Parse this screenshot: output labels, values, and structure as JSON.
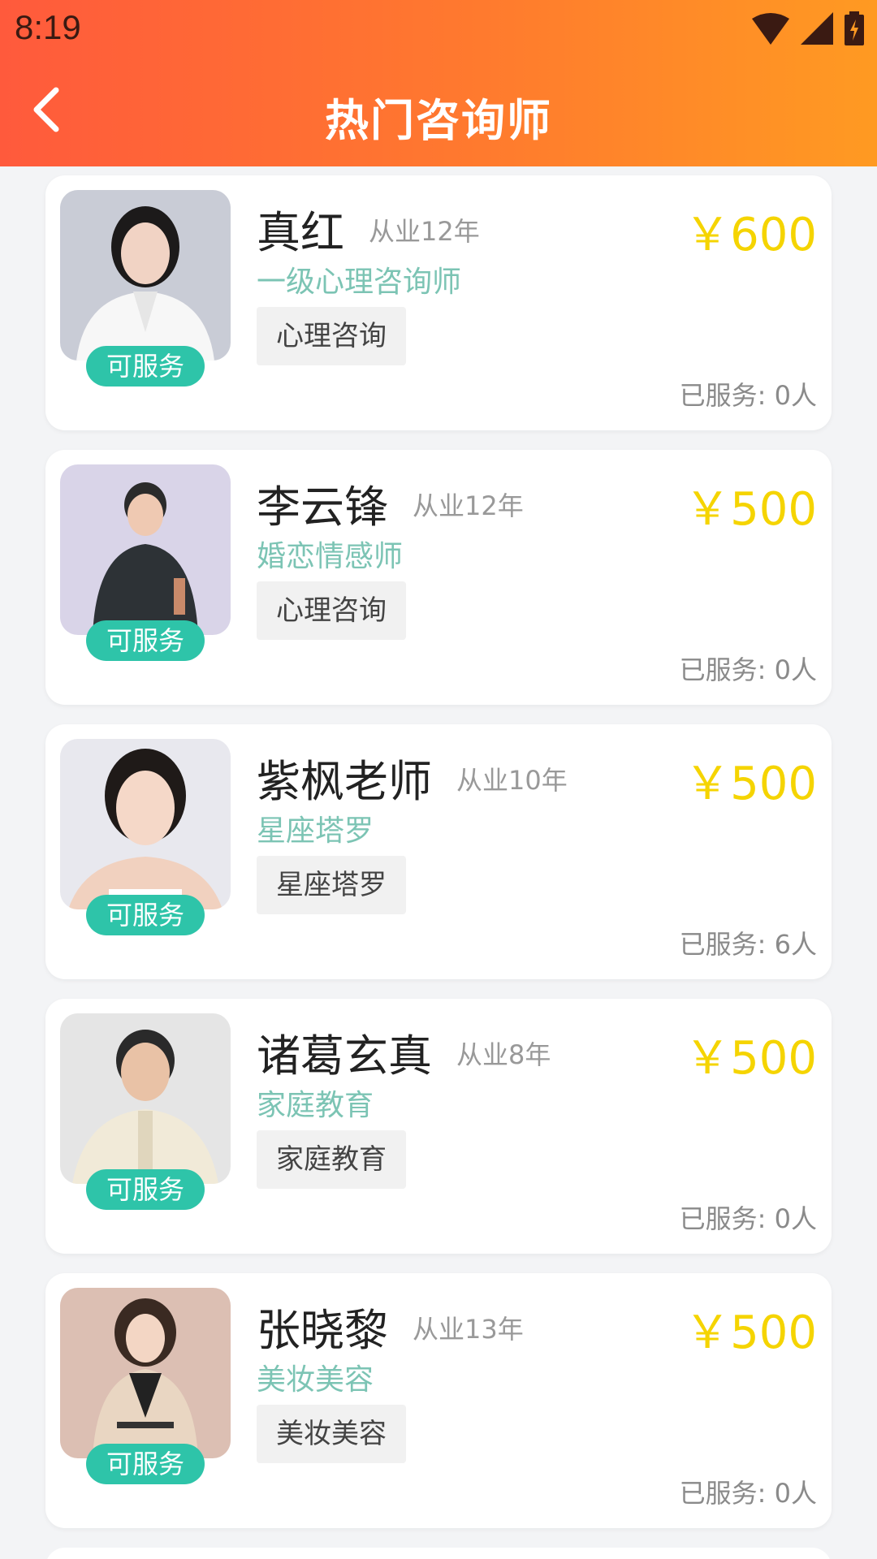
{
  "status_bar": {
    "time": "8:19"
  },
  "header": {
    "title": "热门咨询师"
  },
  "counselors": [
    {
      "name": "真红",
      "years": "从业12年",
      "title": "一级心理咨询师",
      "tag": "心理咨询",
      "price": "￥600",
      "served": "已服务: 0人",
      "badge": "可服务"
    },
    {
      "name": "李云锋",
      "years": "从业12年",
      "title": "婚恋情感师",
      "tag": "心理咨询",
      "price": "￥500",
      "served": "已服务: 0人",
      "badge": "可服务"
    },
    {
      "name": "紫枫老师",
      "years": "从业10年",
      "title": "星座塔罗",
      "tag": "星座塔罗",
      "price": "￥500",
      "served": "已服务: 6人",
      "badge": "可服务"
    },
    {
      "name": "诸葛玄真",
      "years": "从业8年",
      "title": "家庭教育",
      "tag": "家庭教育",
      "price": "￥500",
      "served": "已服务: 0人",
      "badge": "可服务"
    },
    {
      "name": "张晓黎",
      "years": "从业13年",
      "title": "美妆美容",
      "tag": "美妆美容",
      "price": "￥500",
      "served": "已服务: 0人",
      "badge": "可服务"
    }
  ],
  "colors": {
    "header_start": "#ff5a3c",
    "header_end": "#ff9a22",
    "badge": "#2ec4a9",
    "price": "#f5d400",
    "title_text": "#7cc4b4"
  }
}
